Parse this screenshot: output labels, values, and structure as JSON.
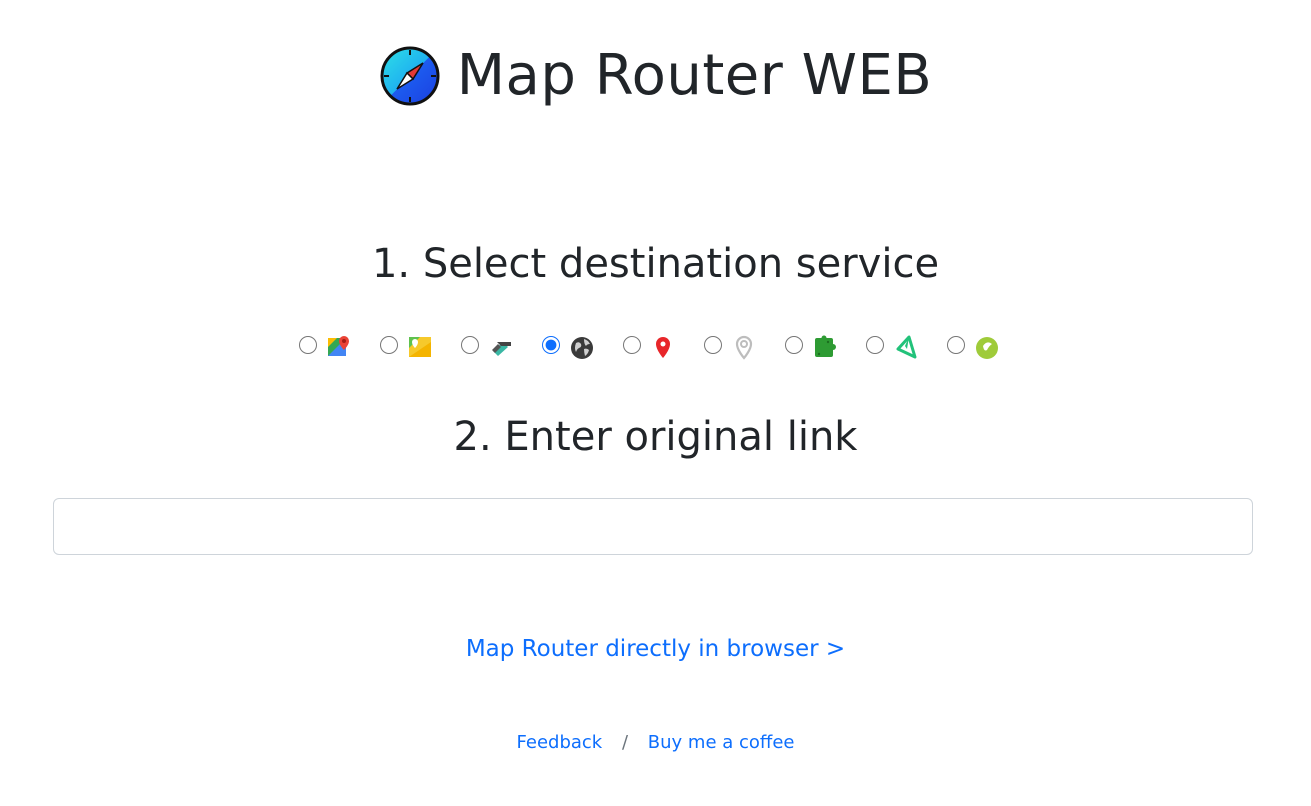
{
  "header": {
    "title": "Map Router WEB",
    "logo_icon": "compass-icon"
  },
  "steps": {
    "step1_title": "1. Select destination service",
    "step2_title": "2. Enter original link"
  },
  "services": {
    "selected_index": 3,
    "options": [
      {
        "icon": "google-maps-icon",
        "checked": false
      },
      {
        "icon": "yandex-maps-icon",
        "checked": false
      },
      {
        "icon": "navigation-arrow-icon",
        "checked": false
      },
      {
        "icon": "globe-icon",
        "checked": true
      },
      {
        "icon": "red-pin-icon",
        "checked": false
      },
      {
        "icon": "gray-pin-icon",
        "checked": false
      },
      {
        "icon": "green-puzzle-icon",
        "checked": false
      },
      {
        "icon": "green-compass-arrow-icon",
        "checked": false
      },
      {
        "icon": "green-circle-2gis-icon",
        "checked": false
      }
    ]
  },
  "link_input": {
    "value": "",
    "placeholder": ""
  },
  "browser_link": {
    "label": "Map Router directly in browser >"
  },
  "footer": {
    "feedback_label": "Feedback",
    "separator": "/",
    "coffee_label": "Buy me a coffee"
  },
  "colors": {
    "link": "#0d6efd",
    "text": "#212529",
    "input_border": "#ced4da"
  }
}
